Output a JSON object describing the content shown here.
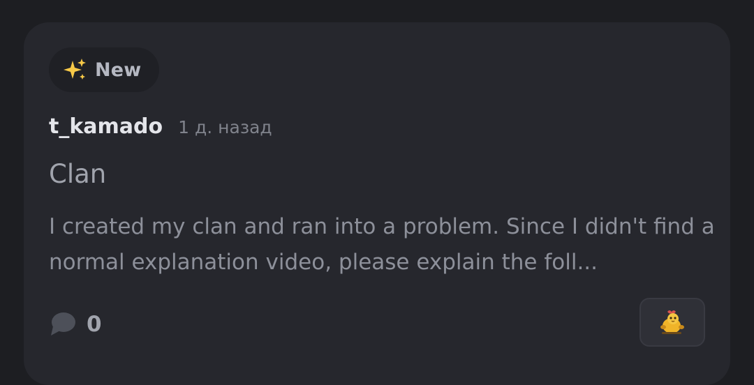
{
  "post": {
    "badge": {
      "label": "New",
      "icon": "sparkles-icon"
    },
    "author": "t_kamado",
    "time": "1 д. назад",
    "title": "Clan",
    "preview": "I created my clan and ran into a problem. Since I didn't find a normal explanation video, please explain the foll...",
    "comments": {
      "icon": "comment-icon",
      "count": "0"
    },
    "reaction": {
      "icon": "sticker-emoji-icon"
    }
  },
  "colors": {
    "background": "#1d1e22",
    "card": "#26272d",
    "sparkle": "#f7c948"
  }
}
